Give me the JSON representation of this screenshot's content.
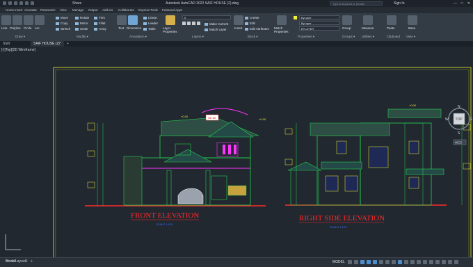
{
  "window": {
    "share_label": "Share",
    "title": "Autodesk AutoCAD 2022   SAIF HOUSE (2).dwg",
    "search_placeholder": "Type a keyword or phrase",
    "signin_label": "Sign In",
    "controls": [
      "—",
      "□",
      "✕"
    ]
  },
  "ribbon_tabs": [
    "Home",
    "Insert",
    "Annotate",
    "Parametric",
    "View",
    "Manage",
    "Output",
    "Add-ins",
    "Collaborate",
    "Express Tools",
    "Featured Apps"
  ],
  "ribbon": {
    "draw": {
      "tools": [
        "Line",
        "Polyline",
        "Circle",
        "Arc"
      ],
      "label": "Draw ▾"
    },
    "modify": {
      "tools": [
        "Move",
        "Rotate",
        "Trim",
        "Copy",
        "Mirror",
        "Fillet",
        "Stretch",
        "Scale",
        "Array"
      ],
      "label": "Modify ▾"
    },
    "annotation": {
      "tools": [
        "Text",
        "Dimension",
        "Linear",
        "Leader",
        "Table"
      ],
      "label": "Annotation ▾"
    },
    "layers": {
      "tools": [
        "Layer Properties",
        "Make Current",
        "Match Layer"
      ],
      "current_layer": "0",
      "label": "Layers ▾"
    },
    "block": {
      "tools": [
        "Insert",
        "Create",
        "Edit",
        "Edit Attributes"
      ],
      "label": "Block ▾"
    },
    "properties": {
      "tools": [
        "Match Properties"
      ],
      "color": "ByLayer",
      "linetype": "ByLayer",
      "lineweight": "BYLAYER",
      "label": "Properties ▾"
    },
    "groups": {
      "tools": [
        "Group"
      ],
      "label": "Groups ▾"
    },
    "utilities": {
      "tools": [
        "Measure"
      ],
      "label": "Utilities ▾"
    },
    "clipboard": {
      "tools": [
        "Paste"
      ],
      "label": "Clipboard"
    },
    "view": {
      "tools": [
        "Base"
      ],
      "label": "View ▾"
    }
  },
  "doc_tabs": {
    "start": "Start",
    "active": "SAIF HOUSE (2)*",
    "add": "+"
  },
  "viewport": {
    "label": "[-][Top][2D Wireframe]",
    "viewcube": {
      "top": "TOP",
      "north": "N",
      "south": "S",
      "west": "W",
      "east": "E",
      "wcs": "WCS"
    }
  },
  "drawing": {
    "front_title": "FRONT ELEVATION",
    "front_scale": "SCALE 1:100",
    "side_title": "RIGHT SIDE ELEVATION",
    "side_scale": "SCALE 1:100",
    "level_tag": "+0.00",
    "sign_text": "SE 58"
  },
  "layout_tabs": [
    "Model",
    "Layout1",
    "+"
  ],
  "status": {
    "mode": "MODEL"
  },
  "colors": {
    "accent": "#4c8fd1",
    "drawing_green": "#23d14f",
    "drawing_yellow": "#f2f232",
    "drawing_red": "#ff2a2a",
    "drawing_magenta": "#ff35ff"
  }
}
